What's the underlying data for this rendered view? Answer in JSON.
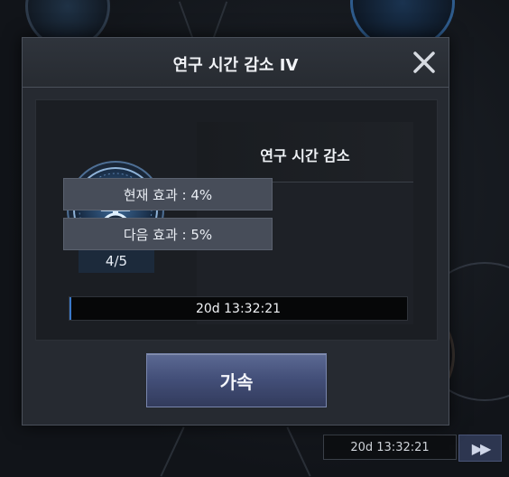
{
  "dialog": {
    "title": "연구 시간 감소 IV",
    "close_icon": "close-icon",
    "effect_name": "연구 시간 감소",
    "current_effect": "현재 효과 : 4%",
    "next_effect": "다음 효과 : 5%",
    "level": "4/5",
    "research_icon": "flask-stopwatch-icon",
    "timer": "20d 13:32:21",
    "speed_up_label": "가속"
  },
  "background": {
    "timer": "20d 13:32:21",
    "fast_forward_icon": "fast-forward-icon"
  },
  "colors": {
    "accent_button": "#44507a",
    "panel": "#262a31",
    "effect_row": "#474d59"
  }
}
